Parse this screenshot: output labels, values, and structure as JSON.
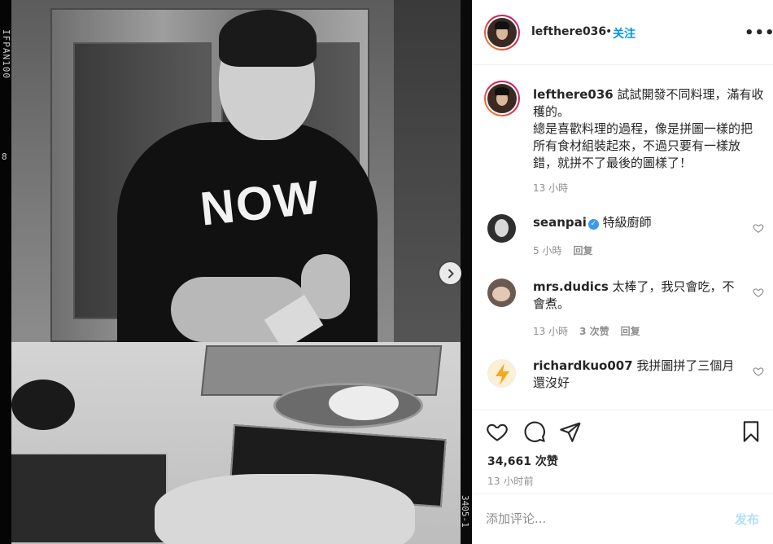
{
  "photo": {
    "film_edge_left": "IFPAN100",
    "film_edge_left_num": "8",
    "film_edge_right": "3405-1",
    "sweater_text": "NOW",
    "next_icon": "chevron-right-icon"
  },
  "header": {
    "username": "lefthere036",
    "separator": "•",
    "follow_label": "关注",
    "more_icon": "more-horizontal-icon"
  },
  "caption": {
    "username": "lefthere036",
    "text": " 試試開發不同料理，滿有收穫的。\n總是喜歡料理的過程，像是拼圖一樣的把所有食材組裝起來，不過只要有一樣放錯，就拼不了最後的圖樣了！",
    "time": "13 小時"
  },
  "comments": [
    {
      "username": "seanpai",
      "verified": true,
      "text": " 特級廚師",
      "time": "5 小時",
      "likes": "",
      "reply_label": "回复"
    },
    {
      "username": "mrs.dudics",
      "verified": false,
      "text": " 太棒了，我只會吃，不會煮。",
      "time": "13 小時",
      "likes": "3 次赞",
      "reply_label": "回复"
    },
    {
      "username": "richardkuo007",
      "verified": false,
      "text": " 我拼圖拼了三個月還沒好",
      "time": "",
      "likes": "",
      "reply_label": ""
    }
  ],
  "actions": {
    "like_icon": "heart-icon",
    "comment_icon": "comment-icon",
    "share_icon": "send-icon",
    "save_icon": "bookmark-icon",
    "likes_text": "34,661 次赞",
    "post_time": "13 小时前"
  },
  "comment_box": {
    "placeholder": "添加评论...",
    "post_label": "发布"
  },
  "colors": {
    "link_blue": "#0095f6",
    "post_disabled": "#b2dffc",
    "verified": "#3897f0",
    "muted": "#8e8e8e"
  }
}
